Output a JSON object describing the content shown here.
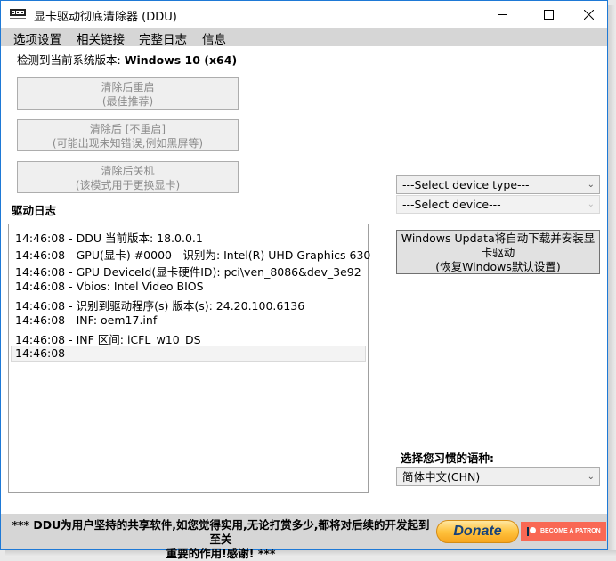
{
  "window": {
    "title": "显卡驱动彻底清除器 (DDU)",
    "icon": "ddu-app-icon",
    "controls": {
      "minimize": "minimize-icon",
      "maximize": "maximize-icon",
      "close": "close-icon"
    }
  },
  "menu": {
    "items": [
      {
        "label": "选项设置"
      },
      {
        "label": "相关链接"
      },
      {
        "label": "完整日志"
      },
      {
        "label": "信息"
      }
    ]
  },
  "system": {
    "label": "检测到当前系统版本: ",
    "value": "Windows 10 (x64)"
  },
  "actions": [
    {
      "line1": "清除后重启",
      "line2": "(最佳推荐)"
    },
    {
      "line1": "清除后 [不重启]",
      "line2": "(可能出现未知错误,例如黑屏等)"
    },
    {
      "line1": "清除后关机",
      "line2": "(该模式用于更换显卡)"
    }
  ],
  "log": {
    "title": "驱动日志",
    "lines": [
      "14:46:08 - DDU 当前版本: 18.0.0.1",
      "14:46:08 - GPU(显卡) #0000 - 识别为: Intel(R) UHD Graphics 630",
      "14:46:08 - GPU DeviceId(显卡硬件ID): pci\\ven_8086&dev_3e92",
      "14:46:08 - Vbios: Intel Video BIOS",
      "14:46:08 - 识别到驱动程序(s) 版本(s): 24.20.100.6136",
      "14:46:08 - INF: oem17.inf",
      "14:46:08 - INF 区间: iCFL_w10_DS",
      "14:46:08 - --------------"
    ],
    "selected_index": 7
  },
  "device_type_select": {
    "value": "---Select device type---"
  },
  "device_select": {
    "value": "---Select device---"
  },
  "windows_update_button": {
    "line1": "Windows Updata将自动下载并安装显",
    "line2": "卡驱动",
    "line3": "(恢复Windows默认设置)"
  },
  "language": {
    "label": "选择您习惯的语种:",
    "value": "简体中文(CHN)"
  },
  "footer": {
    "line1": "*** DDU为用户坚持的共享软件,如您觉得实用,无论打赏多少,都将对后续的开发起到至关",
    "line2": "重要的作用!感谢! ***",
    "donate_label": "Donate",
    "patron_label": "BECOME A PATRON"
  },
  "colors": {
    "window_border": "#1e79d6",
    "menubar_bg": "#d6d6d6",
    "patreon": "#f96854",
    "donate_text": "#17427a",
    "donate_gold": "#ffc23d"
  }
}
